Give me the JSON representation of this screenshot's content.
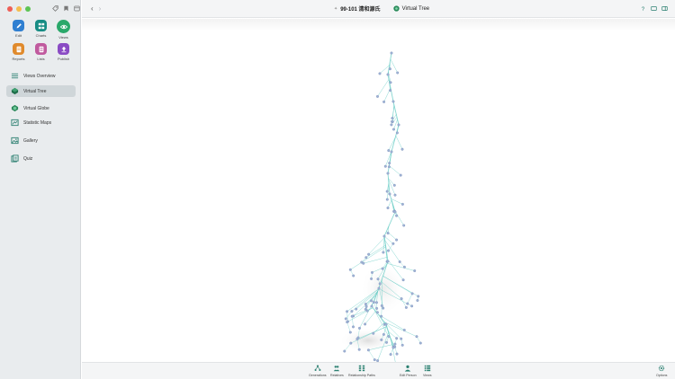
{
  "sidebar": {
    "modules": [
      {
        "label": "Edit",
        "icon": "pencil-icon",
        "color": "#2f7fd1",
        "active": false
      },
      {
        "label": "Charts",
        "icon": "charts-icon",
        "color": "#178c84",
        "active": false
      },
      {
        "label": "Views",
        "icon": "eye-icon",
        "color": "#2aa86a",
        "active": true
      },
      {
        "label": "Reports",
        "icon": "reports-icon",
        "color": "#e08a2c",
        "active": false
      },
      {
        "label": "Lists",
        "icon": "lists-icon",
        "color": "#c05a9e",
        "active": false
      },
      {
        "label": "Publish",
        "icon": "publish-icon",
        "color": "#8a4bc4",
        "active": false
      }
    ],
    "nav_items": [
      {
        "label": "Views Overview",
        "icon": "list-lines-icon"
      },
      {
        "label": "Virtual Tree",
        "icon": "tree-icon",
        "selected": true
      },
      {
        "label": "Virtual Globe",
        "icon": "globe-icon"
      },
      {
        "label": "Statistic Maps",
        "icon": "map-icon"
      },
      {
        "label": "Gallery",
        "icon": "gallery-icon"
      },
      {
        "label": "Quiz",
        "icon": "quiz-icon"
      }
    ]
  },
  "titlebar": {
    "tree_name": "99-101 清和源氏",
    "view_name": "Virtual Tree"
  },
  "bottombar": {
    "buttons": [
      {
        "label": "Generations",
        "icon": "generations-icon"
      },
      {
        "label": "Relatives",
        "icon": "relatives-icon"
      },
      {
        "label": "Relationship Paths",
        "icon": "relationship-paths-icon"
      },
      {
        "label": "Edit Person",
        "icon": "edit-person-icon"
      },
      {
        "label": "Views",
        "icon": "views-icon"
      },
      {
        "label": "Options",
        "icon": "options-gear-icon"
      }
    ]
  },
  "colors": {
    "accent": "#2aa86a",
    "tree_branch": "#5fc9c2",
    "tree_node": "#9fb3d6"
  }
}
